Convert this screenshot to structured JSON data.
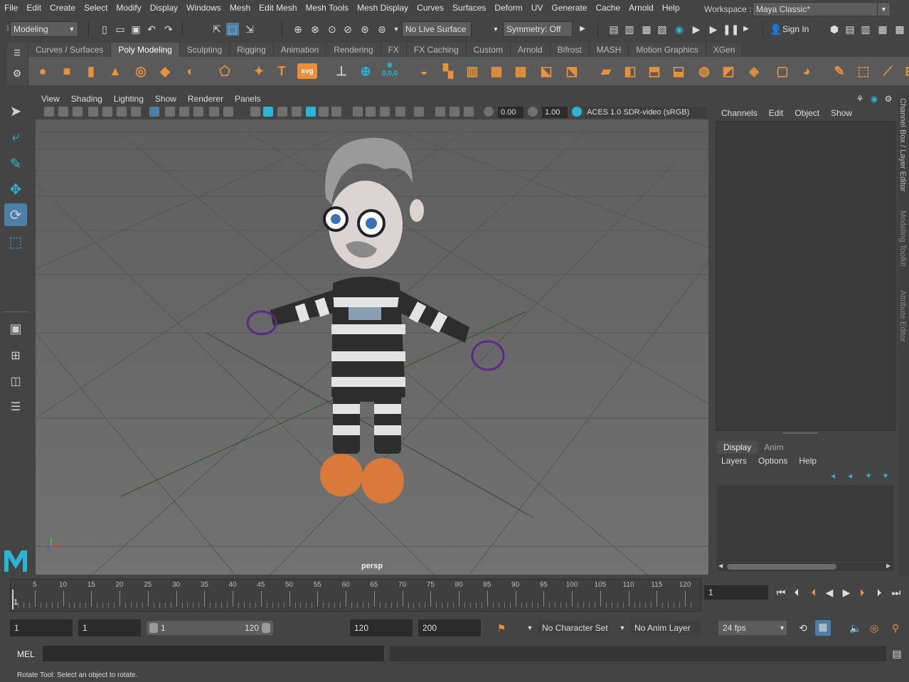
{
  "menubar": {
    "items": [
      "File",
      "Edit",
      "Create",
      "Select",
      "Modify",
      "Display",
      "Windows",
      "Mesh",
      "Edit Mesh",
      "Mesh Tools",
      "Mesh Display",
      "Curves",
      "Surfaces",
      "Deform",
      "UV",
      "Generate",
      "Cache",
      "Arnold",
      "Help"
    ],
    "workspace_label": "Workspace :",
    "workspace_value": "Maya Classic*"
  },
  "status_line": {
    "mode": "Modeling",
    "live_surface": "No Live Surface",
    "symmetry": "Symmetry: Off",
    "sign_in": "Sign In"
  },
  "shelf": {
    "tabs": [
      "Curves / Surfaces",
      "Poly Modeling",
      "Sculpting",
      "Rigging",
      "Animation",
      "Rendering",
      "FX",
      "FX Caching",
      "Custom",
      "Arnold",
      "Bifrost",
      "MASH",
      "Motion Graphics",
      "XGen"
    ],
    "active_tab": "Poly Modeling",
    "text_tool_glyph": "T",
    "svg_tool_label": "svg",
    "tool_glyph_000": "0,0,0"
  },
  "viewport": {
    "panel_menu": [
      "View",
      "Shading",
      "Lighting",
      "Show",
      "Renderer",
      "Panels"
    ],
    "exposure": "0.00",
    "gamma": "1.00",
    "color_space": "ACES 1.0 SDR-video (sRGB)",
    "camera_label": "persp"
  },
  "channel_box": {
    "menu": [
      "Channels",
      "Edit",
      "Object",
      "Show"
    ]
  },
  "layer_editor": {
    "tabs": [
      "Display",
      "Anim"
    ],
    "active_tab": "Display",
    "menu": [
      "Layers",
      "Options",
      "Help"
    ]
  },
  "side_tabs": [
    "Channel Box / Layer Editor",
    "Modeling Toolkit",
    "Attribute Editor"
  ],
  "timeline": {
    "ticks": [
      5,
      10,
      15,
      20,
      25,
      30,
      35,
      40,
      45,
      50,
      55,
      60,
      65,
      70,
      75,
      80,
      85,
      90,
      95,
      100,
      105,
      110,
      115,
      120
    ],
    "current_frame_marker": "1",
    "current_frame": "1"
  },
  "range": {
    "start": "1",
    "playback_start": "1",
    "slider_start": "1",
    "slider_end": "120",
    "playback_end": "120",
    "end": "200",
    "character_set": "No Character Set",
    "anim_layer": "No Anim Layer",
    "fps": "24 fps"
  },
  "command_line": {
    "label": "MEL"
  },
  "help_line": {
    "text": "Rotate Tool: Select an object to rotate."
  },
  "colors": {
    "accent_blue": "#4b7fa8",
    "shelf_orange": "#e8913a",
    "viewport_bg": "#6b6b6b",
    "maya_logo": "#29b6d6"
  }
}
